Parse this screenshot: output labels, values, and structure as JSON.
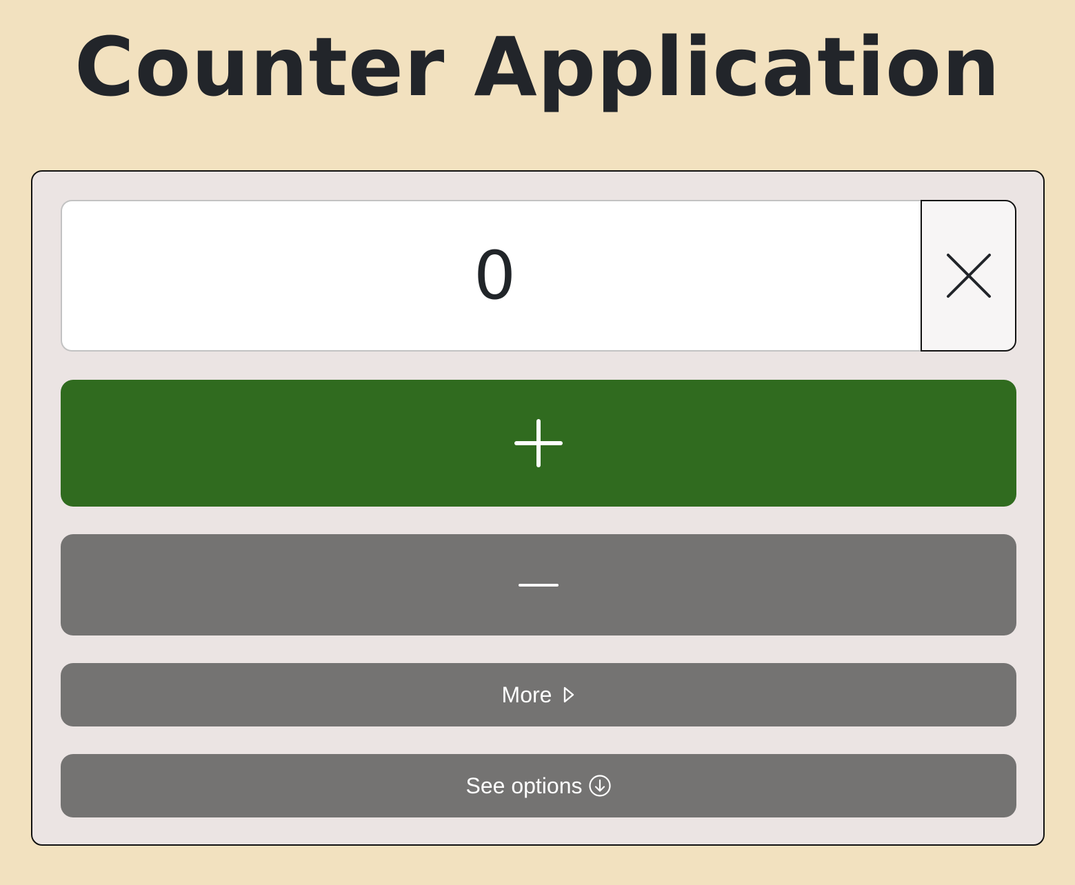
{
  "page": {
    "title": "Counter Application"
  },
  "counter": {
    "value": "0"
  },
  "buttons": {
    "reset_icon": "close-icon",
    "increment_icon": "plus-icon",
    "decrement_icon": "minus-icon",
    "more_label": "More",
    "more_icon": "play-outline-icon",
    "options_label": "See options",
    "options_icon": "arrow-down-circle-icon"
  },
  "colors": {
    "page_background": "#f2e1bf",
    "card_background": "#ebe4e3",
    "increment": "#306b1f",
    "secondary": "#747372",
    "text_dark": "#22252a"
  }
}
